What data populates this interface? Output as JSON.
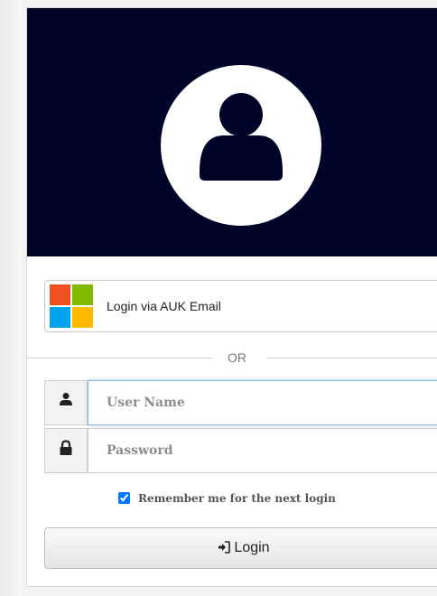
{
  "sso": {
    "label": "Login via AUK Email",
    "logo": "microsoft-logo"
  },
  "divider": {
    "text": "OR"
  },
  "form": {
    "username": {
      "placeholder": "User Name",
      "value": "",
      "icon": "user-icon"
    },
    "password": {
      "placeholder": "Password",
      "value": "",
      "icon": "lock-icon"
    },
    "remember": {
      "label": "Remember me for the next login",
      "checked": true
    },
    "submit": {
      "label": "Login",
      "icon": "sign-in-icon"
    }
  },
  "colors": {
    "hero_bg": "#000328",
    "ms_red": "#f25022",
    "ms_green": "#7fba00",
    "ms_blue": "#00a4ef",
    "ms_yellow": "#ffb900"
  }
}
